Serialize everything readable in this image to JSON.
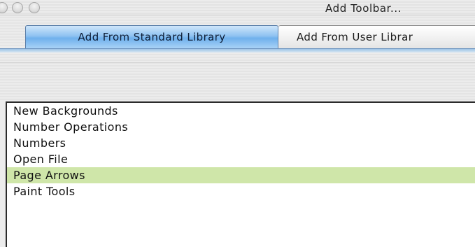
{
  "window": {
    "title": "Add Toolbar..."
  },
  "tabs": [
    {
      "label": "Add From Standard Library",
      "selected": true
    },
    {
      "label": "Add From User Librar",
      "selected": false
    }
  ],
  "list": {
    "items": [
      {
        "label": "New Backgrounds",
        "selected": false
      },
      {
        "label": "Number Operations",
        "selected": false
      },
      {
        "label": "Numbers",
        "selected": false
      },
      {
        "label": "Open File",
        "selected": false
      },
      {
        "label": "Page Arrows",
        "selected": true
      },
      {
        "label": "Paint Tools",
        "selected": false
      }
    ]
  },
  "colors": {
    "selected_tab": "#8fc2f1",
    "selected_row": "#cfe6a9"
  }
}
